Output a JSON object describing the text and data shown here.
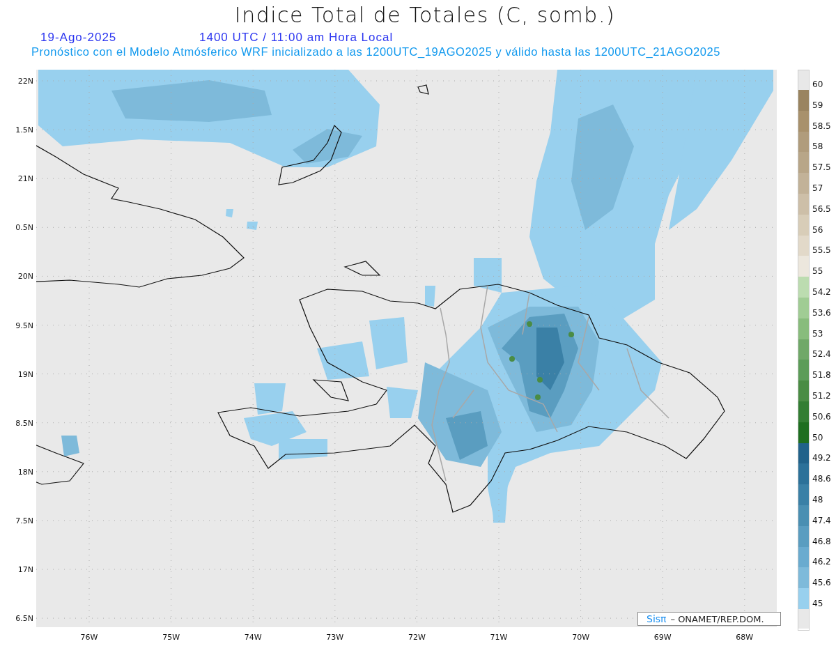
{
  "title": "Indice Total de Totales (C, somb.)",
  "date": "19-Ago-2025",
  "time": "1400 UTC / 11:00 am Hora Local",
  "subtitle": "Pronóstico con el Modelo Atmósferico WRF inicializado a las 1200UTC_19AGO2025 y válido hasta las  1200UTC_21AGO2025",
  "map": {
    "lat_labels": [
      "22N",
      "1.5N",
      "21N",
      "0.5N",
      "20N",
      "9.5N",
      "19N",
      "8.5N",
      "18N",
      "7.5N",
      "17N",
      "6.5N"
    ],
    "lon_labels": [
      "76W",
      "75W",
      "74W",
      "73W",
      "72W",
      "71W",
      "70W",
      "69W",
      "68W"
    ],
    "credit": {
      "brand": "Sisπ",
      "text": "– ONAMET/REP.DOM."
    }
  },
  "colorbar": {
    "segments": [
      {
        "color": "#e8e8e8"
      },
      {
        "color": "#9a8460"
      },
      {
        "color": "#a8916c"
      },
      {
        "color": "#b09c7c"
      },
      {
        "color": "#b8a688"
      },
      {
        "color": "#c2b298"
      },
      {
        "color": "#cdbfa8"
      },
      {
        "color": "#d8cdb8"
      },
      {
        "color": "#e2d9c9"
      },
      {
        "color": "#ece7dd"
      },
      {
        "color": "#bcdcb0"
      },
      {
        "color": "#a0cc94"
      },
      {
        "color": "#88bc7c"
      },
      {
        "color": "#70a868"
      },
      {
        "color": "#5c9c58"
      },
      {
        "color": "#4a8c44"
      },
      {
        "color": "#337d33"
      },
      {
        "color": "#1e6e20"
      },
      {
        "color": "#21628a"
      },
      {
        "color": "#2c7199"
      },
      {
        "color": "#3a80a6"
      },
      {
        "color": "#4a8fb2"
      },
      {
        "color": "#5a9dc0"
      },
      {
        "color": "#6aabcf"
      },
      {
        "color": "#7ebada"
      },
      {
        "color": "#98d0ee"
      },
      {
        "color": "#e8e8e8"
      }
    ],
    "labels": [
      "60",
      "59",
      "58.5",
      "58",
      "57.5",
      "57",
      "56.5",
      "56",
      "55.5",
      "55",
      "54.2",
      "53.6",
      "53",
      "52.4",
      "51.8",
      "51.2",
      "50.6",
      "50",
      "49.2",
      "48.6",
      "48",
      "47.4",
      "46.8",
      "46.2",
      "45.6",
      "45"
    ]
  }
}
